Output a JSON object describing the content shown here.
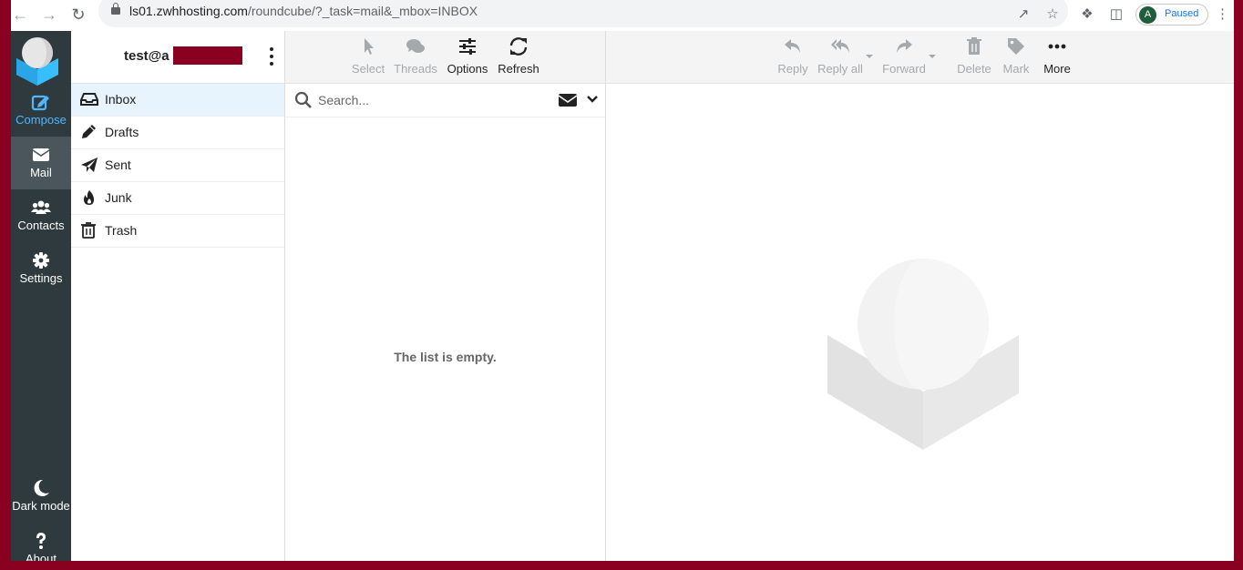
{
  "browser": {
    "url_host": "ls01.zwhhosting.com",
    "url_path": "/roundcube/?_task=mail&_mbox=INBOX",
    "profile_initial": "A",
    "profile_status": "Paused"
  },
  "rail": {
    "items": [
      {
        "label": "Compose",
        "icon": "compose-icon"
      },
      {
        "label": "Mail",
        "icon": "envelope-icon"
      },
      {
        "label": "Contacts",
        "icon": "users-icon"
      },
      {
        "label": "Settings",
        "icon": "gear-icon"
      }
    ],
    "bottom": [
      {
        "label": "Dark mode",
        "icon": "moon-icon"
      },
      {
        "label": "About",
        "icon": "question-icon"
      }
    ]
  },
  "account": {
    "name": "test@a"
  },
  "folders": [
    {
      "label": "Inbox",
      "icon": "inbox-icon"
    },
    {
      "label": "Drafts",
      "icon": "pencil-icon"
    },
    {
      "label": "Sent",
      "icon": "paper-plane-icon"
    },
    {
      "label": "Junk",
      "icon": "fire-icon"
    },
    {
      "label": "Trash",
      "icon": "trash-icon"
    }
  ],
  "list_toolbar": {
    "select": "Select",
    "threads": "Threads",
    "options": "Options",
    "refresh": "Refresh"
  },
  "search": {
    "placeholder": "Search..."
  },
  "list": {
    "empty_message": "The list is empty."
  },
  "message_toolbar": {
    "reply": "Reply",
    "reply_all": "Reply all",
    "forward": "Forward",
    "delete": "Delete",
    "mark": "Mark",
    "more": "More"
  },
  "colors": {
    "rail_bg": "#2f3a3f",
    "accent": "#4fb6ff",
    "active_folder_bg": "#e7f4fd",
    "frame": "#8a0020"
  }
}
